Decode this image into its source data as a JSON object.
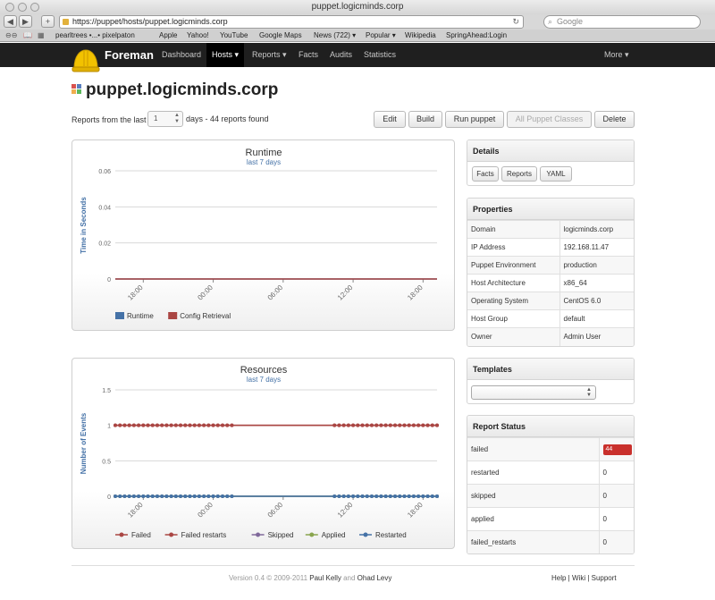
{
  "browser": {
    "window_title": "puppet.logicminds.corp",
    "url": "https://puppet/hosts/puppet.logicminds.corp",
    "search_placeholder": "Google",
    "bookmarks": [
      "pearltrees •...• pixelpaton",
      "Apple",
      "Yahoo!",
      "YouTube",
      "Google Maps",
      "News (722) ▾",
      "Popular ▾",
      "Wikipedia",
      "SpringAhead:Login"
    ]
  },
  "nav": {
    "brand": "Foreman",
    "items": [
      "Dashboard",
      "Hosts ▾",
      "Reports ▾",
      "Facts",
      "Audits",
      "Statistics"
    ],
    "active_index": 1,
    "more": "More ▾"
  },
  "host": {
    "name": "puppet.logicminds.corp",
    "reports_prefix": "Reports from the last",
    "days_value": "1",
    "reports_suffix": "days - 44 reports found"
  },
  "actions": {
    "edit": "Edit",
    "build": "Build",
    "run_puppet": "Run puppet",
    "all_puppet_classes": "All Puppet Classes",
    "delete": "Delete"
  },
  "runtime_chart": {
    "title": "Runtime",
    "subtitle": "last 7 days",
    "ylabel": "Time in Seconds",
    "yticks": [
      "0.06",
      "0.04",
      "0.02",
      "0"
    ],
    "xticks": [
      "18:00",
      "00:00",
      "06:00",
      "12:00",
      "18:00"
    ],
    "legend": [
      "Runtime",
      "Config Retrieval"
    ]
  },
  "resources_chart": {
    "title": "Resources",
    "subtitle": "last 7 days",
    "ylabel": "Number of Events",
    "yticks": [
      "1.5",
      "1",
      "0.5",
      "0"
    ],
    "xticks": [
      "18:00",
      "00:00",
      "06:00",
      "12:00",
      "18:00"
    ],
    "legend": [
      "Failed",
      "Failed restarts",
      "Skipped",
      "Applied",
      "Restarted"
    ]
  },
  "chart_data": [
    {
      "type": "line",
      "title": "Runtime",
      "subtitle": "last 7 days",
      "ylabel": "Time in Seconds",
      "xlabel": "",
      "ylim": [
        0,
        0.06
      ],
      "x": [
        "18:00",
        "00:00",
        "06:00",
        "12:00",
        "18:00"
      ],
      "series": [
        {
          "name": "Runtime",
          "color": "#4572a7",
          "values": [
            0,
            0,
            0,
            0,
            0
          ]
        },
        {
          "name": "Config Retrieval",
          "color": "#aa4643",
          "values": [
            0,
            0,
            0,
            0,
            0
          ]
        }
      ],
      "grid": true,
      "legend": "bottom-left"
    },
    {
      "type": "line",
      "title": "Resources",
      "subtitle": "last 7 days",
      "ylabel": "Number of Events",
      "xlabel": "",
      "ylim": [
        0,
        1.5
      ],
      "x": [
        "18:00",
        "00:00",
        "06:00",
        "12:00",
        "18:00"
      ],
      "series": [
        {
          "name": "Failed",
          "color": "#aa4643",
          "values": [
            1,
            1,
            1,
            1,
            1
          ]
        },
        {
          "name": "Failed restarts",
          "color": "#aa4643",
          "values": [
            1,
            1,
            1,
            1,
            1
          ]
        },
        {
          "name": "Skipped",
          "color": "#80699b",
          "values": [
            0,
            0,
            0,
            0,
            0
          ]
        },
        {
          "name": "Applied",
          "color": "#89a54e",
          "values": [
            0,
            0,
            0,
            0,
            0
          ]
        },
        {
          "name": "Restarted",
          "color": "#4572a7",
          "values": [
            0,
            0,
            0,
            0,
            0
          ]
        }
      ],
      "grid": true,
      "legend": "bottom-left"
    }
  ],
  "details": {
    "title": "Details",
    "buttons": [
      "Facts",
      "Reports",
      "YAML"
    ]
  },
  "properties": {
    "title": "Properties",
    "rows": [
      {
        "key": "Domain",
        "value": "logicminds.corp"
      },
      {
        "key": "IP Address",
        "value": "192.168.11.47"
      },
      {
        "key": "Puppet Environment",
        "value": "production"
      },
      {
        "key": "Host Architecture",
        "value": "x86_64"
      },
      {
        "key": "Operating System",
        "value": "CentOS 6.0"
      },
      {
        "key": "Host Group",
        "value": "default"
      },
      {
        "key": "Owner",
        "value": "Admin User"
      }
    ]
  },
  "templates": {
    "title": "Templates",
    "selected": ""
  },
  "report_status": {
    "title": "Report Status",
    "rows": [
      {
        "key": "failed",
        "value": "44"
      },
      {
        "key": "restarted",
        "value": "0"
      },
      {
        "key": "skipped",
        "value": "0"
      },
      {
        "key": "applied",
        "value": "0"
      },
      {
        "key": "failed_restarts",
        "value": "0"
      }
    ]
  },
  "footer": {
    "version": "Version 0.4 © 2009-2011",
    "author1": "Paul Kelly",
    "and": "and",
    "author2": "Ohad Levy",
    "help": "Help",
    "wiki": "Wiki",
    "support": "Support"
  },
  "colors": {
    "nav_bg": "#1f1f1f",
    "failed_badge": "#c9302c",
    "series_blue": "#4572a7",
    "series_red": "#aa4643"
  }
}
